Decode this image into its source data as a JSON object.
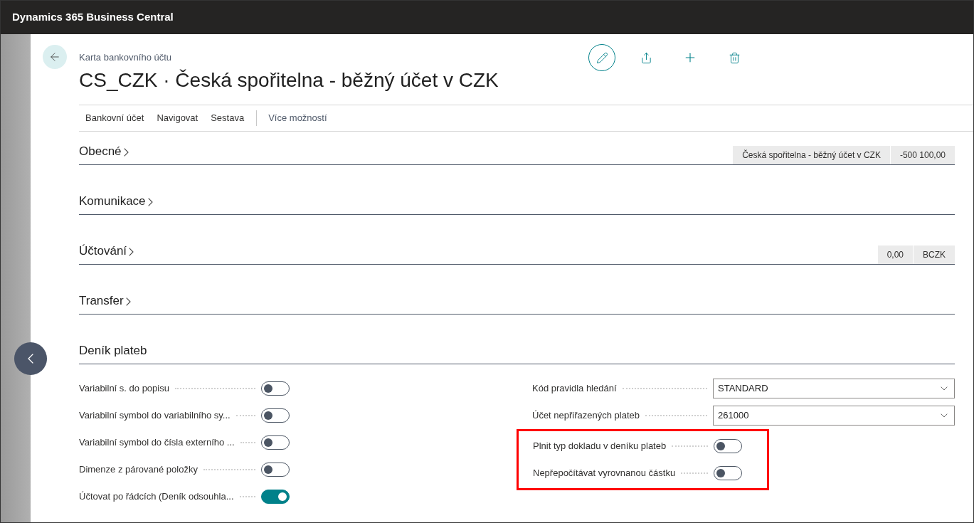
{
  "app_bar": {
    "title": "Dynamics 365 Business Central"
  },
  "page": {
    "breadcrumb": "Karta bankovního účtu",
    "title": "CS_CZK · Česká spořitelna - běžný účet v CZK"
  },
  "action_bar": {
    "items": [
      "Bankovní účet",
      "Navigovat",
      "Sestava"
    ],
    "more": "Více možností"
  },
  "sections": [
    {
      "name": "Obecné",
      "expanded": false,
      "facts": [
        "Česká spořitelna - běžný účet v CZK",
        "-500 100,00"
      ]
    },
    {
      "name": "Komunikace",
      "expanded": false
    },
    {
      "name": "Účtování",
      "expanded": false,
      "facts": [
        "0,00",
        "BCZK"
      ]
    },
    {
      "name": "Transfer",
      "expanded": false
    },
    {
      "name": "Deník plateb",
      "expanded": true
    }
  ],
  "fields_left": [
    {
      "kind": "toggle",
      "label": "Variabilní s. do popisu",
      "on": false
    },
    {
      "kind": "toggle",
      "label": "Variabilní symbol do variabilního sy...",
      "on": false
    },
    {
      "kind": "toggle",
      "label": "Variabilní symbol do čísla externího ...",
      "on": false
    },
    {
      "kind": "toggle",
      "label": "Dimenze z párované položky",
      "on": false
    },
    {
      "kind": "toggle",
      "label": "Účtovat po řádcích (Deník odsouhla...",
      "on": true
    }
  ],
  "fields_right": [
    {
      "kind": "select",
      "label": "Kód pravidla hledání",
      "value": "STANDARD",
      "highlighted": false
    },
    {
      "kind": "select",
      "label": "Účet nepřiřazených plateb",
      "value": "261000",
      "highlighted": false
    },
    {
      "kind": "toggle",
      "label": "Plnit typ dokladu v deníku plateb",
      "on": false,
      "highlighted": true
    },
    {
      "kind": "toggle",
      "label": "Nepřepočítávat vyrovnanou částku",
      "on": false,
      "highlighted": true
    }
  ]
}
